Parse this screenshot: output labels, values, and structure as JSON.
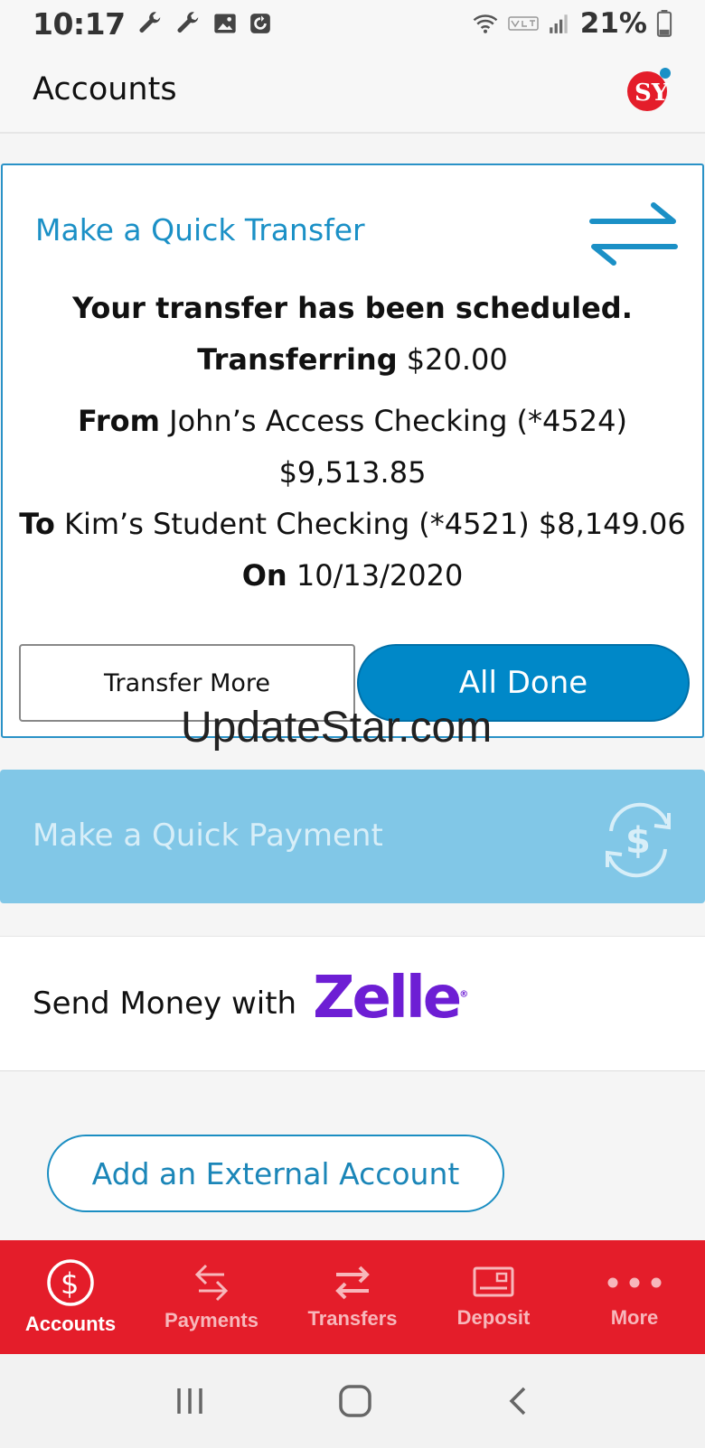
{
  "status_bar": {
    "time": "10:17",
    "battery": "21%",
    "left_icons": [
      "wrench-icon",
      "wrench-icon",
      "image-icon",
      "sync-icon"
    ],
    "right_icons": [
      "wifi-icon",
      "volte-icon",
      "signal-icon",
      "battery-icon"
    ]
  },
  "header": {
    "title": "Accounts",
    "logo_text": "SY"
  },
  "transfer_card": {
    "title": "Make a Quick Transfer",
    "confirmation": "Your transfer has been scheduled.",
    "amount_label": "Transferring",
    "amount_value": "$20.00",
    "from_label": "From",
    "from_account": "John’s Access Checking (*4524)",
    "from_balance": "$9,513.85",
    "to_label": "To",
    "to_account": "Kim’s Student Checking (*4521) $8,149.06",
    "on_label": "On",
    "on_date": "10/13/2020",
    "transfer_more_label": "Transfer More",
    "all_done_label": "All Done"
  },
  "watermark": "UpdateStar.com",
  "payment_card": {
    "title": "Make a Quick Payment"
  },
  "zelle": {
    "text": "Send Money with",
    "logo": "Zelle",
    "reg": "®"
  },
  "external_account_label": "Add an External Account",
  "bottom_nav": {
    "items": [
      {
        "label": "Accounts",
        "icon": "dollar-circle-icon",
        "active": true
      },
      {
        "label": "Payments",
        "icon": "payments-arrows-icon",
        "active": false
      },
      {
        "label": "Transfers",
        "icon": "transfer-arrows-icon",
        "active": false
      },
      {
        "label": "Deposit",
        "icon": "check-deposit-icon",
        "active": false
      },
      {
        "label": "More",
        "icon": "more-dots-icon",
        "active": false
      }
    ]
  },
  "colors": {
    "accent_blue": "#1b90c6",
    "nav_red": "#e41d2a",
    "zelle_purple": "#6d1ed4"
  }
}
